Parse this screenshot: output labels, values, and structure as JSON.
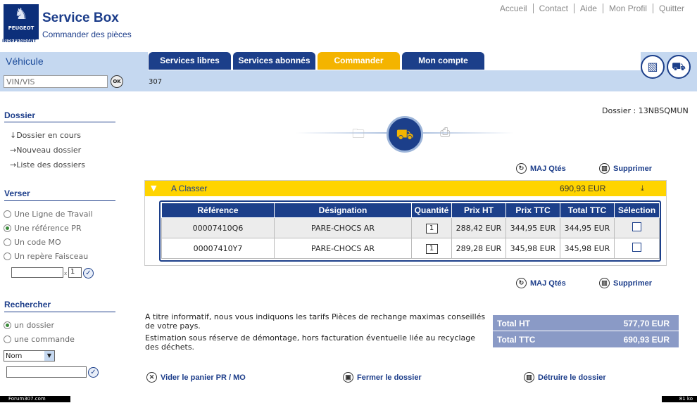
{
  "header": {
    "logo_text": "PEUGEOT",
    "logo_sub": "INDEPENDANT",
    "title": "Service Box",
    "subtitle": "Commander des pièces",
    "links": [
      "Accueil",
      "Contact",
      "Aide",
      "Mon Profil",
      "Quitter"
    ]
  },
  "vehicle": {
    "label": "Véhicule",
    "vin_placeholder": "VIN/VIS",
    "ok_label": "OK",
    "model": "307"
  },
  "tabs": [
    {
      "label": "Services libres",
      "active": false
    },
    {
      "label": "Services abonnés",
      "active": false
    },
    {
      "label": "Commander",
      "active": true
    },
    {
      "label": "Mon compte",
      "active": false
    }
  ],
  "sidebar": {
    "dossier_title": "Dossier",
    "dossier_links": [
      "↓Dossier en cours",
      "→Nouveau dossier",
      "→Liste des dossiers"
    ],
    "verser_title": "Verser",
    "verser_options": [
      "Une Ligne de Travail",
      "Une référence PR",
      "Un code MO",
      "Un repère Faisceau"
    ],
    "verser_selected": 1,
    "verser_qty": "1",
    "rechercher_title": "Rechercher",
    "rechercher_options": [
      "un dossier",
      "une commande"
    ],
    "rechercher_selected": 0,
    "search_select": "Nom"
  },
  "main": {
    "dossier_label": "Dossier  : 13NBSQMUN",
    "maj_label": "MAJ Qtés",
    "supprimer_label": "Supprimer",
    "cart_label": "A Classer",
    "cart_total": "690,93  EUR",
    "columns": [
      "Référence",
      "Désignation",
      "Quantité",
      "Prix HT",
      "Prix TTC",
      "Total TTC",
      "Sélection"
    ],
    "rows": [
      {
        "ref": "00007410Q6",
        "designation": "PARE-CHOCS AR",
        "qty": "1",
        "prix_ht": "288,42 EUR",
        "prix_ttc": "344,95 EUR",
        "total_ttc": "344,95 EUR"
      },
      {
        "ref": "00007410Y7",
        "designation": "PARE-CHOCS AR",
        "qty": "1",
        "prix_ht": "289,28 EUR",
        "prix_ttc": "345,98 EUR",
        "total_ttc": "345,98 EUR"
      }
    ],
    "note1": "A titre informatif, nous vous indiquons les tarifs Pièces de rechange maximas conseillés de votre pays.",
    "note2": "Estimation sous réserve de démontage, hors facturation éventuelle liée au recyclage des déchets.",
    "total_ht_label": "Total HT",
    "total_ht_value": "577,70  EUR",
    "total_ttc_label": "Total TTC",
    "total_ttc_value": "690,93  EUR",
    "vider_label": "Vider le panier PR / MO",
    "fermer_label": "Fermer le dossier",
    "detruire_label": "Détruire le dossier"
  },
  "status": {
    "left": "Forum307.com",
    "right": "81 ko"
  },
  "colors": {
    "brand_blue": "#1c3f8a",
    "accent_yellow": "#f4b400",
    "band_blue": "#c5d8f0",
    "totals_bg": "#8a9ac6"
  }
}
